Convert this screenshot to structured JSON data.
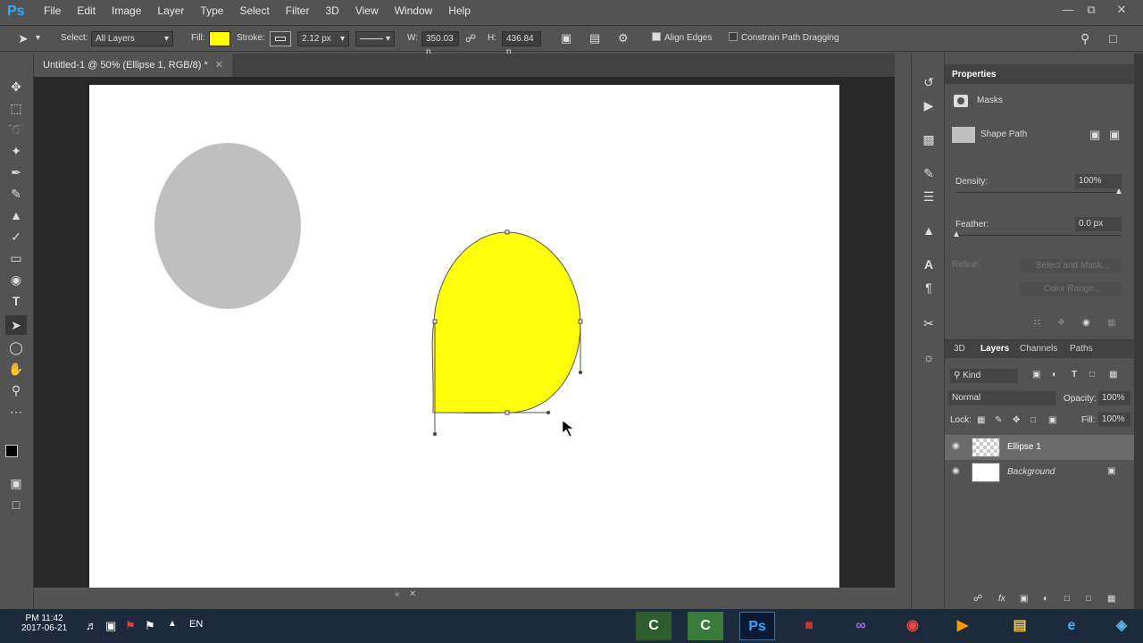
{
  "app": {
    "logo": "Ps"
  },
  "menu": [
    "File",
    "Edit",
    "Image",
    "Layer",
    "Type",
    "Select",
    "Filter",
    "3D",
    "View",
    "Window",
    "Help"
  ],
  "options": {
    "select_label": "Select:",
    "select_value": "All Layers",
    "fill_label": "Fill:",
    "fill_color": "#ffff00",
    "stroke_label": "Stroke:",
    "stroke_width": "2.12 px",
    "w_label": "W:",
    "w_value": "350.03 p",
    "h_label": "H:",
    "h_value": "436.84 p",
    "align_edges": "Align Edges",
    "constrain": "Constrain Path Dragging"
  },
  "document": {
    "tab_title": "Untitled-1 @ 50% (Ellipse 1, RGB/8) *"
  },
  "shapes": {
    "gray_color": "#bfbfbf",
    "yellow_color": "#ffff0a"
  },
  "properties": {
    "title": "Properties",
    "masks": "Masks",
    "shape_path": "Shape Path",
    "density_label": "Density:",
    "density_value": "100%",
    "feather_label": "Feather:",
    "feather_value": "0.0 px",
    "refine_label": "Refine:",
    "select_mask": "Select and Mask...",
    "color_range": "Color Range..."
  },
  "layers_panel": {
    "tabs": [
      "3D",
      "Layers",
      "Channels",
      "Paths"
    ],
    "kind": "Kind",
    "blend": "Normal",
    "opacity_label": "Opacity:",
    "opacity_value": "100%",
    "lock_label": "Lock:",
    "fill_label": "Fill:",
    "fill_value": "100%",
    "layers": [
      {
        "name": "Ellipse 1"
      },
      {
        "name": "Background"
      }
    ]
  },
  "taskbar": {
    "time": "PM 11:42",
    "date": "2017-06-21",
    "lang": "EN"
  }
}
